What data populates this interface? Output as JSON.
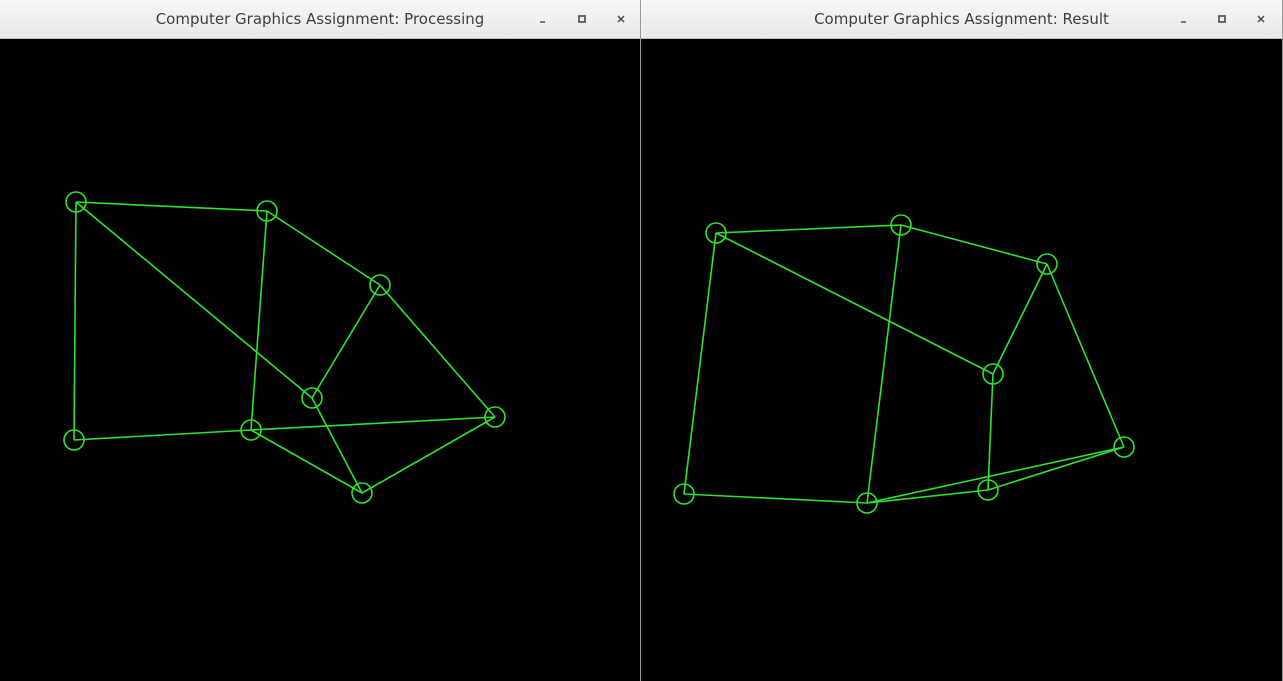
{
  "windows": {
    "processing": {
      "title": "Computer Graphics Assignment: Processing",
      "buttons": {
        "minimize": "-",
        "maximize": "□",
        "close": "×"
      }
    },
    "result": {
      "title": "Computer Graphics Assignment: Result",
      "buttons": {
        "minimize": "-",
        "maximize": "□",
        "close": "×"
      }
    }
  },
  "colors": {
    "stroke": "#2ee32e",
    "canvas_bg": "#000000"
  }
}
